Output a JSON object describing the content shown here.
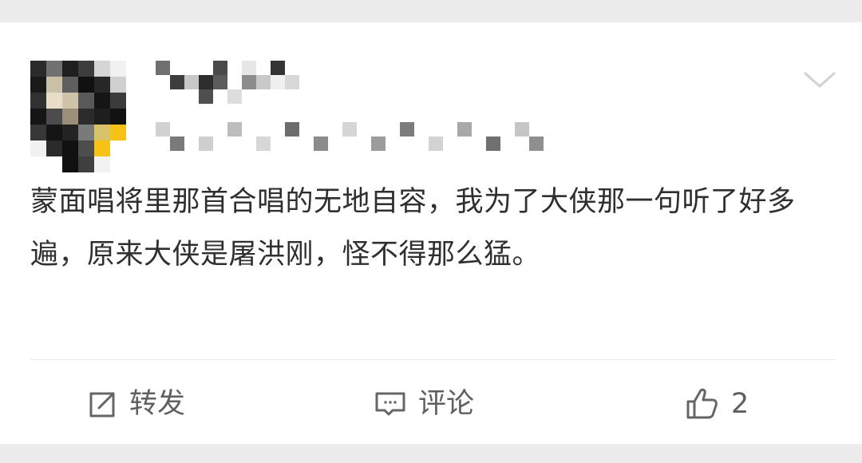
{
  "card": {
    "post_text": "蒙面唱将里那首合唱的无地自容，我为了大侠那一句听了好多遍，原来大侠是屠洪刚，怪不得那么猛。"
  },
  "actions": {
    "repost_label": "转发",
    "comment_label": "评论",
    "like_count": "2"
  },
  "icons": {
    "menu": "chevron-down-icon",
    "repost": "share-icon",
    "comment": "comment-icon",
    "like": "thumbs-up-icon"
  },
  "colors": {
    "page_background": "#ececec",
    "card_background": "#ffffff",
    "text_primary": "#2f2f2f",
    "text_secondary": "#5f5f5f",
    "divider": "#e7e7e7",
    "accent_yellow": "#f6c215"
  }
}
